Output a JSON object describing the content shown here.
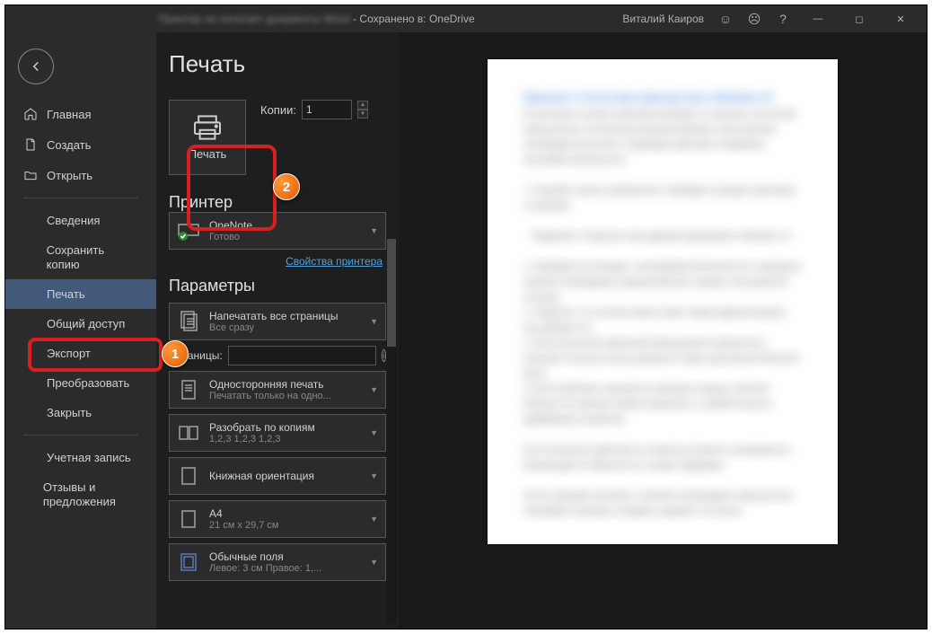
{
  "titlebar": {
    "doc_blur": "Принтер не печатает документы Word",
    "saved": "- Сохранено в: OneDrive",
    "user": "Виталий Каиров"
  },
  "sidebar": {
    "home": "Главная",
    "create": "Создать",
    "open": "Открыть",
    "info": "Сведения",
    "savecopy": "Сохранить копию",
    "print": "Печать",
    "share": "Общий доступ",
    "export": "Экспорт",
    "transform": "Преобразовать",
    "close": "Закрыть",
    "account": "Учетная запись",
    "feedback": "Отзывы и предложения"
  },
  "page": {
    "title": "Печать",
    "print_label": "Печать",
    "copies": "Копии:",
    "copies_val": "1",
    "printer_h": "Принтер",
    "printer_name": "OneNote",
    "printer_status": "Готово",
    "printer_props": "Свойства принтера",
    "params_h": "Параметры",
    "pages_lbl": "Страницы:",
    "opts": [
      {
        "t": "Напечатать все страницы",
        "s": "Все сразу"
      },
      {
        "t": "Односторонняя печать",
        "s": "Печатать только на одно..."
      },
      {
        "t": "Разобрать по копиям",
        "s": "1,2,3   1,2,3   1,2,3"
      },
      {
        "t": "Книжная ориентация",
        "s": ""
      },
      {
        "t": "A4",
        "s": "21 см x 29,7 см"
      },
      {
        "t": "Обычные поля",
        "s": "Левое: 3 см   Правое: 1,..."
      }
    ]
  },
  "markers": {
    "one": "1",
    "two": "2"
  }
}
